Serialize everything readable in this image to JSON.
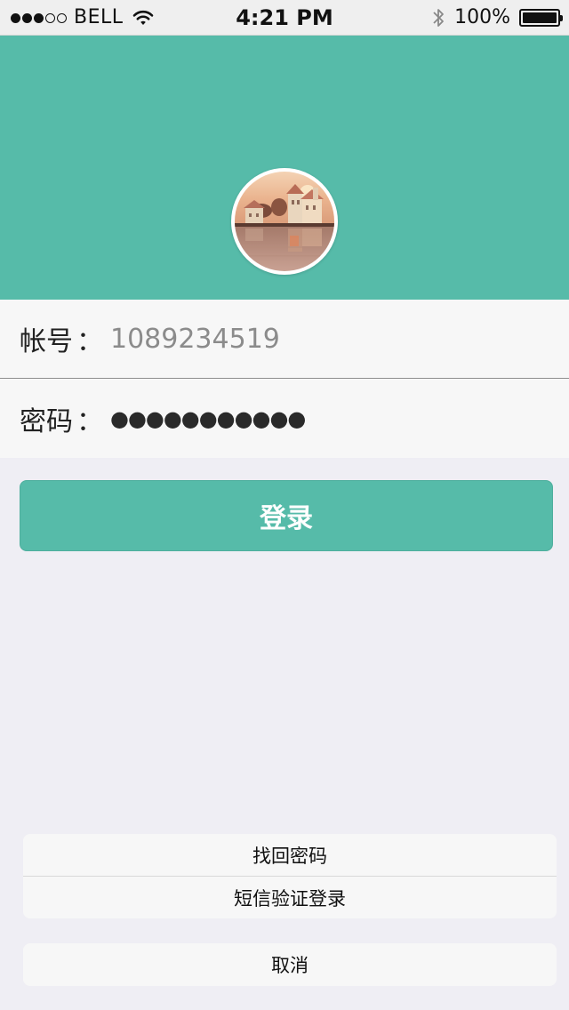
{
  "status_bar": {
    "carrier": "BELL",
    "time": "4:21 PM",
    "battery_percent": "100%",
    "signal_bars_filled": 3,
    "signal_bars_total": 5
  },
  "colors": {
    "accent": "#56bba9",
    "background": "#efeef4"
  },
  "login_form": {
    "account_label": "帐号",
    "account_value": "1089234519",
    "password_label": "密码",
    "password_value": "●●●●●●●●●●●",
    "colon": "："
  },
  "login_button_label": "登录",
  "action_sheet": {
    "items": [
      {
        "label": "找回密码"
      },
      {
        "label": "短信验证登录"
      }
    ],
    "cancel_label": "取消"
  }
}
